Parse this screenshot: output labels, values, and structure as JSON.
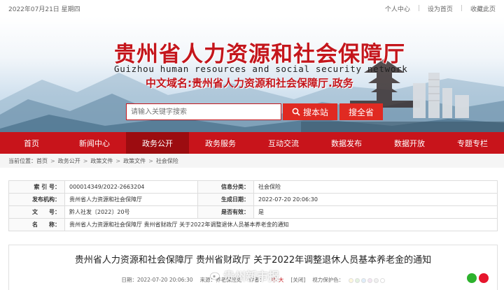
{
  "topbar": {
    "date": "2022年07月21日 星期四",
    "links": [
      "个人中心",
      "设为首页",
      "收藏此页"
    ]
  },
  "banner": {
    "title_cn": "贵州省人力资源和社会保障厅",
    "title_en": "Guizhou human resources and social security network",
    "domain": "中文域名:贵州省人力资源和社会保障厅.政务"
  },
  "search": {
    "placeholder": "请输入关键字搜索",
    "button": "搜本站",
    "province_button": "搜全省"
  },
  "nav": {
    "items": [
      "首页",
      "新闻中心",
      "政务公开",
      "政务服务",
      "互动交流",
      "数据发布",
      "数据开放",
      "专题专栏"
    ],
    "active": "政务公开"
  },
  "breadcrumb": {
    "label": "当前位置：",
    "items": [
      "首页",
      "政务公开",
      "政策文件",
      "政策文件",
      "社会保险"
    ]
  },
  "meta": {
    "rows": [
      {
        "l1": "索 引 号：",
        "v1": "000014349/2022-2663204",
        "l2": "信息分类：",
        "v2": "社会保险"
      },
      {
        "l1": "发布机构：",
        "v1": "贵州省人力资源和社会保障厅",
        "l2": "生成日期：",
        "v2": "2022-07-20 20:06:30"
      },
      {
        "l1": "文　　号：",
        "v1": "黔人社发〔2022〕20号",
        "l2": "是否有效：",
        "v2": "是"
      }
    ],
    "name_label": "名　　称：",
    "name_value": "贵州省人力资源和社会保障厅 贵州省财政厅 关于2022年调整退休人员基本养老金的通知"
  },
  "article": {
    "title": "贵州省人力资源和社会保障厅 贵州省财政厅 关于2022年调整退休人员基本养老金的通知",
    "date": "日期：2022-07-20 20:06:30",
    "source": "来源：养老保险处",
    "author": "作者：",
    "font_big": "大",
    "font_mid": "中",
    "close": "[关闭]",
    "protect": "视力保护色：",
    "swatches": [
      "#fff8dc",
      "#e4f3e0",
      "#dfeefb",
      "#f3e5f2",
      "#f0f0f0",
      "#ffffff"
    ]
  },
  "watermark": "贵州新市报"
}
